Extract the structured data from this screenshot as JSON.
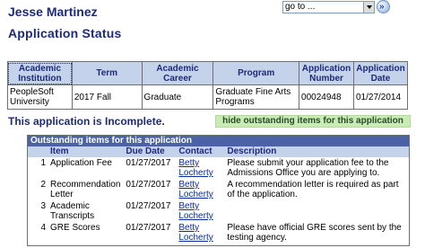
{
  "header": {
    "user_name": "Jesse Martinez",
    "goto_value": "go to ...",
    "go_button_glyph": "»"
  },
  "page_title": "Application Status",
  "application_table": {
    "headers": [
      "Academic Institution",
      "Term",
      "Academic Career",
      "Program",
      "Application Number",
      "Application Date"
    ],
    "rows": [
      [
        "PeopleSoft University",
        "2017 Fall",
        "Graduate",
        "Graduate Fine Arts Programs",
        "00024948",
        "01/27/2014"
      ]
    ]
  },
  "status_message": "This application is Incomplete.",
  "hide_button_label": "hide outstanding items for this application",
  "outstanding": {
    "title": "Outstanding items for this application",
    "headers": [
      "Item",
      "Due Date",
      "Contact",
      "Description"
    ],
    "rows": [
      {
        "num": "1",
        "item": "Application Fee",
        "due": "01/27/2017",
        "contact": "Betty Locherty",
        "desc": "Please submit your application fee to the Admissions Office you are applying to."
      },
      {
        "num": "2",
        "item": "Recommendation Letter",
        "due": "01/27/2017",
        "contact": "Betty Locherty",
        "desc": "A recommendation letter is required as part of the application."
      },
      {
        "num": "3",
        "item": "Academic Transcripts",
        "due": "01/27/2017",
        "contact": "Betty Locherty",
        "desc": ""
      },
      {
        "num": "4",
        "item": "GRE Scores",
        "due": "01/27/2017",
        "contact": "Betty Locherty",
        "desc": "Please have official GRE scores sent by the testing agency."
      }
    ]
  }
}
